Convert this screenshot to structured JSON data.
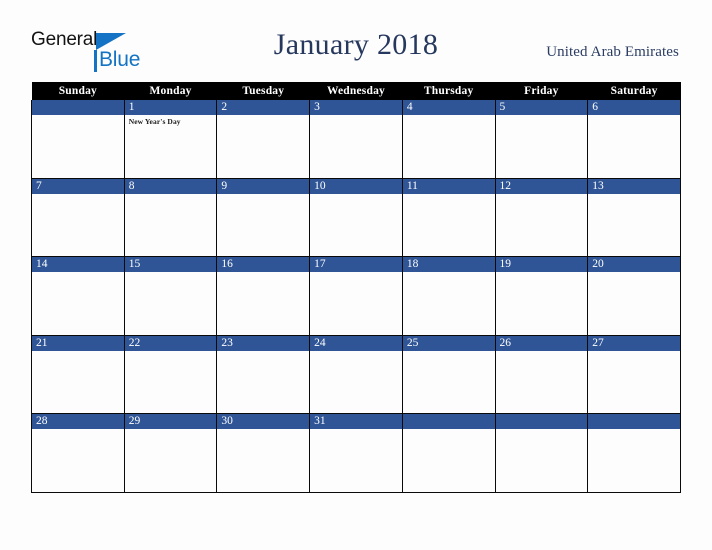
{
  "brand": {
    "name_part1": "General",
    "name_part2": "Blue",
    "color_black": "#131313",
    "color_blue": "#1473c4"
  },
  "header": {
    "title": "January 2018",
    "country": "United Arab Emirates",
    "title_color": "#26385e"
  },
  "calendar": {
    "weekday_headers": [
      "Sunday",
      "Monday",
      "Tuesday",
      "Wednesday",
      "Thursday",
      "Friday",
      "Saturday"
    ],
    "header_bg": "#000000",
    "header_text_color": "#ffffff",
    "daybar_bg": "#2f5596",
    "daybar_text_color": "#ffffff",
    "grid_border_color": "#0a0a0a",
    "cell_bg": "#fdfdfd",
    "weeks": [
      [
        {
          "day": "",
          "events": []
        },
        {
          "day": "1",
          "events": [
            "New Year's Day"
          ]
        },
        {
          "day": "2",
          "events": []
        },
        {
          "day": "3",
          "events": []
        },
        {
          "day": "4",
          "events": []
        },
        {
          "day": "5",
          "events": []
        },
        {
          "day": "6",
          "events": []
        }
      ],
      [
        {
          "day": "7",
          "events": []
        },
        {
          "day": "8",
          "events": []
        },
        {
          "day": "9",
          "events": []
        },
        {
          "day": "10",
          "events": []
        },
        {
          "day": "11",
          "events": []
        },
        {
          "day": "12",
          "events": []
        },
        {
          "day": "13",
          "events": []
        }
      ],
      [
        {
          "day": "14",
          "events": []
        },
        {
          "day": "15",
          "events": []
        },
        {
          "day": "16",
          "events": []
        },
        {
          "day": "17",
          "events": []
        },
        {
          "day": "18",
          "events": []
        },
        {
          "day": "19",
          "events": []
        },
        {
          "day": "20",
          "events": []
        }
      ],
      [
        {
          "day": "21",
          "events": []
        },
        {
          "day": "22",
          "events": []
        },
        {
          "day": "23",
          "events": []
        },
        {
          "day": "24",
          "events": []
        },
        {
          "day": "25",
          "events": []
        },
        {
          "day": "26",
          "events": []
        },
        {
          "day": "27",
          "events": []
        }
      ],
      [
        {
          "day": "28",
          "events": []
        },
        {
          "day": "29",
          "events": []
        },
        {
          "day": "30",
          "events": []
        },
        {
          "day": "31",
          "events": []
        },
        {
          "day": "",
          "events": []
        },
        {
          "day": "",
          "events": []
        },
        {
          "day": "",
          "events": []
        }
      ]
    ]
  }
}
